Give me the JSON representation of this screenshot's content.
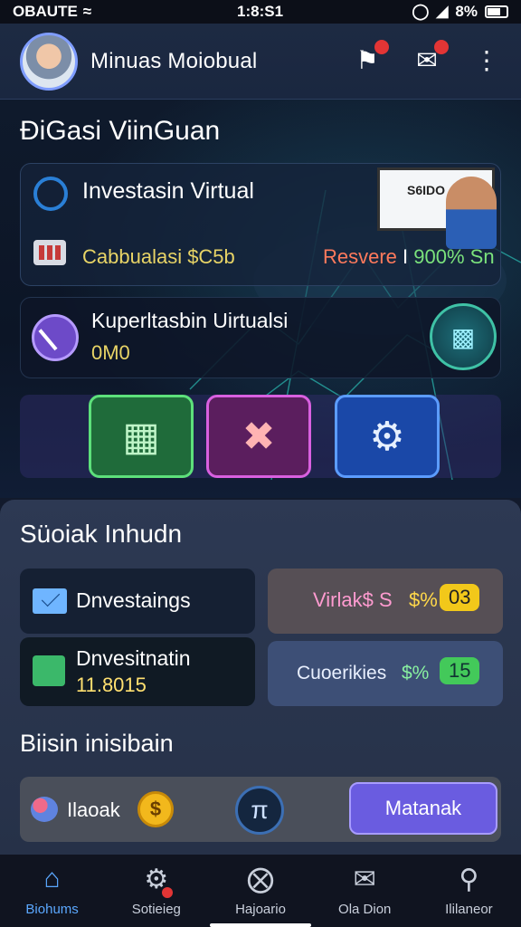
{
  "status_bar": {
    "carrier": "OBAUTE",
    "time": "1:8:S1",
    "battery": "8%"
  },
  "header": {
    "user_name": "Minuas Moiobual",
    "icons": [
      "bookmark-icon",
      "chat-icon",
      "more-icon"
    ]
  },
  "hero": {
    "title": "ĐiGasi ViinGuan",
    "card_investasi": {
      "title": "Investasin Virtual",
      "calc_label": "Cabbualasi $C5b",
      "reserve_prefix": "Resvere",
      "reserve_sep": " I ",
      "reserve_value": "900% Sn",
      "screen_text": "S6IDO"
    },
    "card_kuper": {
      "title": "Kuperltasbin Uirtualsi",
      "value": "0M0"
    },
    "tiles": [
      {
        "name": "document-icon"
      },
      {
        "name": "tools-icon"
      },
      {
        "name": "settings-icon"
      }
    ]
  },
  "panel": {
    "title": "Süoiak Inhudn",
    "stat1": {
      "label": "Dnvestaings"
    },
    "stat2": {
      "label": "Virlak$ S",
      "pct": "$%",
      "badge": "03"
    },
    "stat3": {
      "label": "Dnvesitnatin",
      "value": "11.8015"
    },
    "stat4": {
      "label": "Cuoerikies",
      "pct": "$%",
      "badge": "15"
    },
    "subtitle": "Biisin inisibain",
    "action": {
      "label": "Ilaoak",
      "coin": "$",
      "pi": "π",
      "button": "Matanak"
    }
  },
  "tabs": [
    {
      "label": "Biohums",
      "icon": "home-icon",
      "active": true
    },
    {
      "label": "Sotieieg",
      "icon": "gear-icon",
      "active": false
    },
    {
      "label": "Hajoario",
      "icon": "compass-icon",
      "active": false
    },
    {
      "label": "Ola Dion",
      "icon": "mail-icon",
      "active": false
    },
    {
      "label": "Ililaneor",
      "icon": "search-icon",
      "active": false
    }
  ],
  "colors": {
    "accent": "#5ba8ff",
    "yellow": "#e8d466",
    "green": "#43c95a",
    "button": "#6a5ce0"
  }
}
